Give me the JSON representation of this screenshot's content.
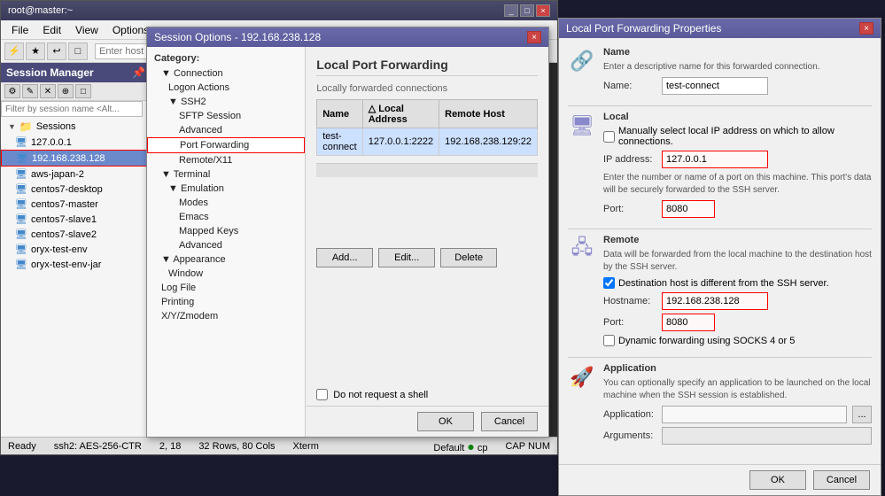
{
  "mainWindow": {
    "titleBar": {
      "title": "root@master:~",
      "buttons": [
        "_",
        "□",
        "×"
      ]
    },
    "menuItems": [
      "File",
      "Edit",
      "View",
      "Options"
    ],
    "toolbar": {
      "enterHostPlaceholder": "Enter host <A",
      "buttons": [
        "⚡",
        "★",
        "↩",
        "□",
        "✎",
        "✕",
        "⊕"
      ]
    }
  },
  "sessionManager": {
    "title": "Session Manager",
    "filterPlaceholder": "Filter by session name <Alt...",
    "toolbarButtons": [
      "⚙",
      "✎",
      "✕",
      "⊕",
      "□"
    ],
    "sessions": {
      "rootLabel": "Sessions",
      "items": [
        {
          "name": "127.0.0.1",
          "type": "session"
        },
        {
          "name": "192.168.238.128",
          "type": "session",
          "selected": true,
          "highlighted": true
        },
        {
          "name": "aws-japan-2",
          "type": "session"
        },
        {
          "name": "centos7-desktop",
          "type": "session"
        },
        {
          "name": "centos7-master",
          "type": "session"
        },
        {
          "name": "centos7-slave1",
          "type": "session"
        },
        {
          "name": "centos7-slave2",
          "type": "session"
        },
        {
          "name": "oryx-test-env",
          "type": "session"
        },
        {
          "name": "oryx-test-env-jar",
          "type": "session"
        }
      ]
    }
  },
  "statusBar": {
    "ready": "Ready",
    "encryption": "ssh2: AES-256-CTR",
    "position": "2, 18",
    "size": "32 Rows, 80 Cols",
    "terminal": "Xterm",
    "capsNum": "CAP NUM",
    "defaultLabel": "Default",
    "cpLabel": "cp"
  },
  "sessionOptions": {
    "title": "Session Options - 192.168.238.128",
    "categoryLabel": "Category:",
    "categories": {
      "connection": {
        "label": "Connection",
        "children": [
          {
            "label": "Logon Actions",
            "indent": true
          },
          {
            "label": "SSH2",
            "indent": true
          },
          {
            "label": "SFTP Session",
            "indent": 2
          },
          {
            "label": "Advanced",
            "indent": 2
          },
          {
            "label": "Port Forwarding",
            "indent": 2,
            "highlighted": true
          },
          {
            "label": "Remote/X11",
            "indent": 2
          }
        ]
      },
      "terminal": {
        "label": "Terminal",
        "children": [
          {
            "label": "Emulation",
            "indent": true
          },
          {
            "label": "Modes",
            "indent": 2
          },
          {
            "label": "Emacs",
            "indent": 2
          },
          {
            "label": "Mapped Keys",
            "indent": 2
          },
          {
            "label": "Advanced",
            "indent": 2
          }
        ]
      },
      "appearance": {
        "label": "Appearance",
        "indent": true,
        "children": [
          {
            "label": "Window",
            "indent": 2
          }
        ]
      },
      "others": [
        {
          "label": "Log File"
        },
        {
          "label": "Printing"
        },
        {
          "label": "X/Y/Zmodem"
        }
      ]
    },
    "content": {
      "sectionTitle": "Local Port Forwarding",
      "subsectionLabel": "Locally forwarded connections",
      "tableHeaders": [
        "Name",
        "Local Address",
        "Remote Host"
      ],
      "tableRows": [
        {
          "name": "test-connect",
          "localAddress": "127.0.0.1:2222",
          "remoteHost": "192.168.238.129:22"
        }
      ]
    },
    "buttons": {
      "add": "Add...",
      "edit": "Edit...",
      "delete": "Delete",
      "ok": "OK",
      "cancel": "Cancel"
    },
    "doNotRequestShell": "Do not request a shell"
  },
  "lpfDialog": {
    "title": "Local Port Forwarding Properties",
    "nameSection": {
      "label": "Name",
      "description": "Enter a descriptive name for this forwarded connection.",
      "nameLabel": "Name:",
      "nameValue": "test-connect"
    },
    "localSection": {
      "label": "Local",
      "checkboxLabel": "Manually select local IP address on which to allow connections.",
      "ipLabel": "IP address:",
      "ipValue": "127.0.0.1",
      "portDesc": "Enter the number or name of a port on this machine. This port's data will be securely forwarded to the SSH server.",
      "portLabel": "Port:",
      "portValue": "8080"
    },
    "remoteSection": {
      "label": "Remote",
      "description": "Data will be forwarded from the local machine to the destination host by the SSH server.",
      "checkboxLabel": "Destination host is different from the SSH server.",
      "hostnameLabel": "Hostname:",
      "hostnameValue": "192.168.238.128",
      "portLabel": "Port:",
      "portValue": "8080",
      "socksLabel": "Dynamic forwarding using SOCKS 4 or 5"
    },
    "applicationSection": {
      "label": "Application",
      "description": "You can optionally specify an application to be launched on the local machine when the SSH session is established.",
      "applicationLabel": "Application:",
      "applicationValue": "",
      "argumentsLabel": "Arguments:",
      "argumentsValue": ""
    },
    "buttons": {
      "ok": "OK",
      "cancel": "Cancel"
    }
  }
}
